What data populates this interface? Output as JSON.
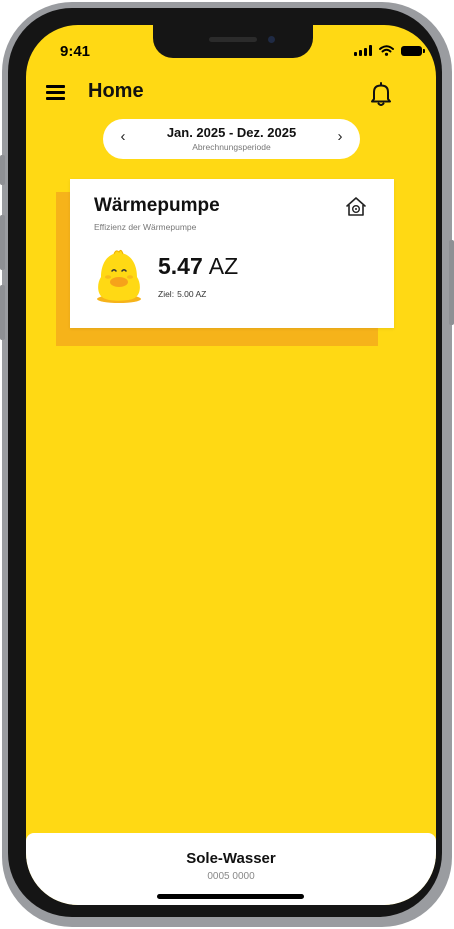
{
  "status_bar": {
    "time": "9:41"
  },
  "header": {
    "title": "Home",
    "menu_icon": "hamburger-menu-icon",
    "notification_icon": "bell-icon"
  },
  "period": {
    "range": "Jan. 2025 - Dez. 2025",
    "label": "Abrechnungsperiode",
    "prev": "‹",
    "next": "›"
  },
  "card": {
    "title": "Wärmepumpe",
    "subtitle": "Effizienz der Wärmepumpe",
    "value": "5.47",
    "unit": "AZ",
    "target_label": "Ziel:",
    "target_value": "5.00 AZ",
    "icon": "house-settings-icon",
    "mascot": "smiling-duck-mascot"
  },
  "bottom_panel": {
    "title": "Sole-Wasser",
    "subtitle": "0005 0000"
  },
  "colors": {
    "accent": "#FFD914",
    "card_shadow": "#F6B31A",
    "text": "#111111"
  }
}
